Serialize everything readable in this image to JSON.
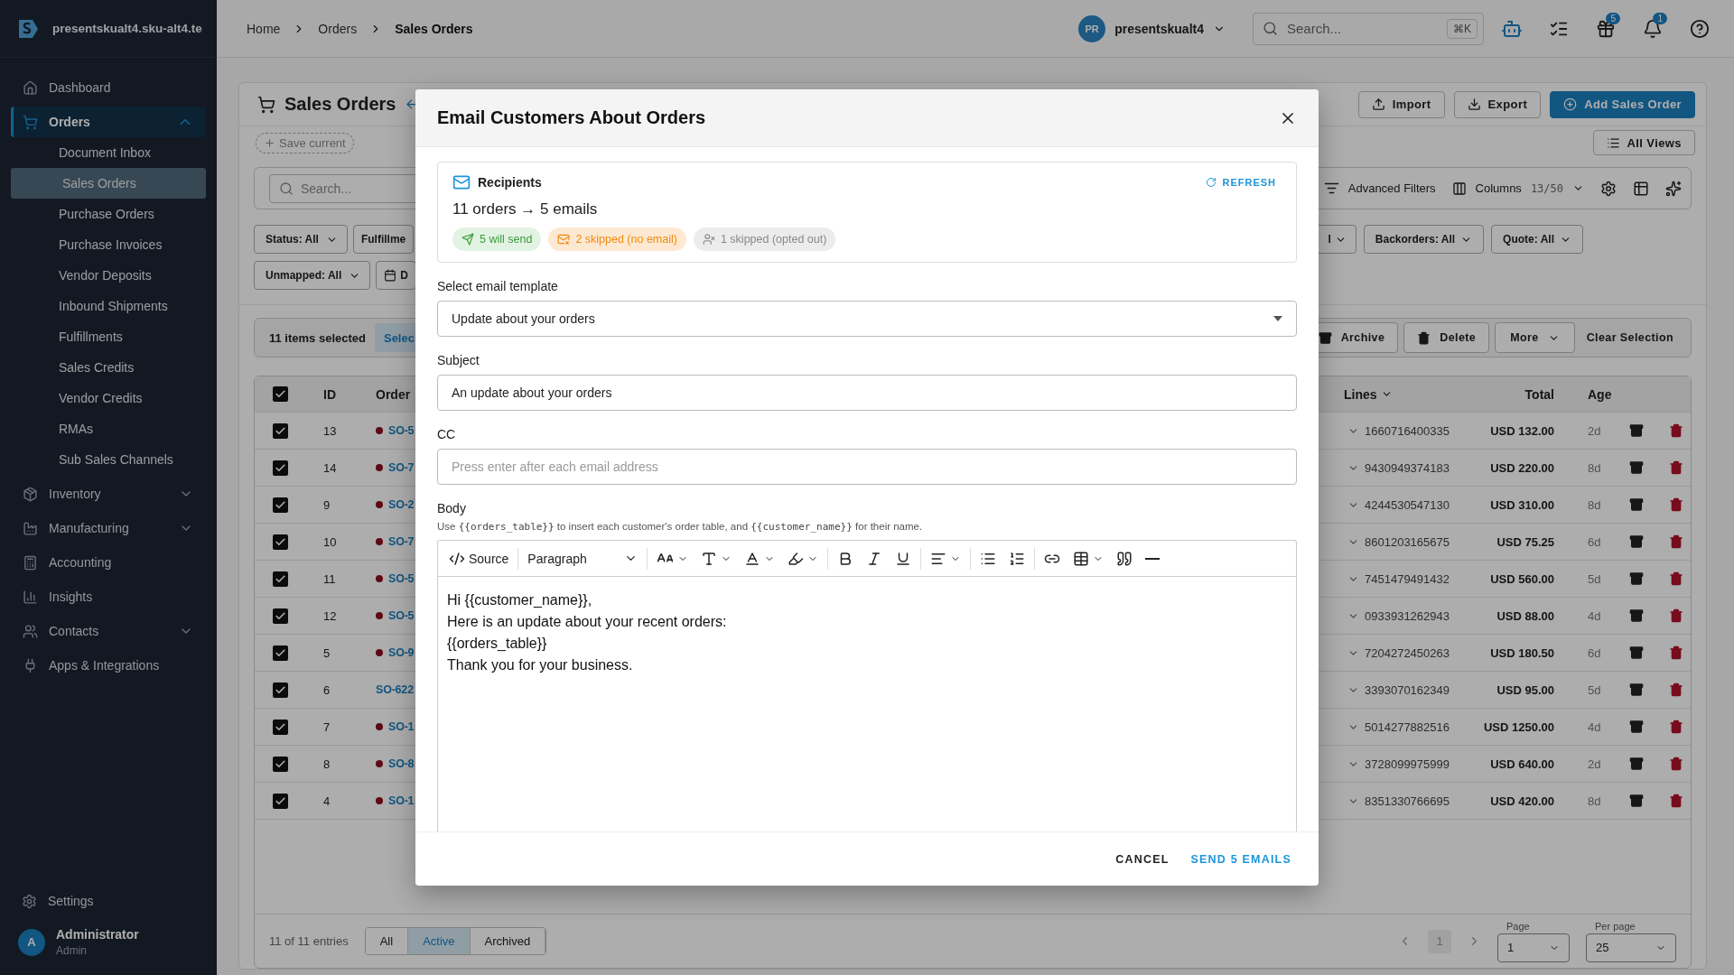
{
  "sidebar": {
    "workspace": "presentskualt4.sku-alt4.te",
    "items": [
      {
        "label": "Dashboard",
        "kind": "link",
        "selected": false
      },
      {
        "label": "Orders",
        "kind": "group",
        "expanded": true,
        "selected": true,
        "children": [
          {
            "label": "Document Inbox",
            "selected": false
          },
          {
            "label": "Sales Orders",
            "selected": true
          },
          {
            "label": "Purchase Orders",
            "selected": false
          },
          {
            "label": "Purchase Invoices",
            "selected": false
          },
          {
            "label": "Vendor Deposits",
            "selected": false
          },
          {
            "label": "Inbound Shipments",
            "selected": false
          },
          {
            "label": "Fulfillments",
            "selected": false
          },
          {
            "label": "Sales Credits",
            "selected": false
          },
          {
            "label": "Vendor Credits",
            "selected": false
          },
          {
            "label": "RMAs",
            "selected": false
          },
          {
            "label": "Sub Sales Channels",
            "selected": false
          }
        ]
      },
      {
        "label": "Inventory",
        "kind": "group",
        "expanded": false,
        "selected": false
      },
      {
        "label": "Manufacturing",
        "kind": "group",
        "expanded": false,
        "selected": false
      },
      {
        "label": "Accounting",
        "kind": "link",
        "selected": false
      },
      {
        "label": "Insights",
        "kind": "link",
        "selected": false
      },
      {
        "label": "Contacts",
        "kind": "group",
        "expanded": false,
        "selected": false
      },
      {
        "label": "Apps & Integrations",
        "kind": "link",
        "selected": false
      }
    ],
    "settings": "Settings",
    "user": {
      "initial": "A",
      "name": "Administrator",
      "role": "Admin"
    }
  },
  "header": {
    "breadcrumbs": [
      "Home",
      "Orders",
      "Sales Orders"
    ],
    "account": {
      "initials": "PR",
      "name": "presentskualt4"
    },
    "search": {
      "placeholder": "Search...",
      "shortcut": "⌘K"
    },
    "gift_badge": "5",
    "bell_badge": "1"
  },
  "page": {
    "title": "Sales Orders",
    "actions": [
      "Import",
      "Export",
      "Add Sales Order"
    ],
    "save_view": "Save current",
    "views": "All Views",
    "search": {
      "placeholder": "Search..."
    },
    "advanced_filters": "Advanced Filters",
    "columns": {
      "label": "Columns",
      "count": "13/50"
    },
    "filters_left": [
      [
        "Status: All",
        "Fulfillme"
      ],
      [
        "Unmapped: All",
        "D"
      ]
    ],
    "filters_right": [
      "l",
      "Backorders: All",
      "Quote: All"
    ],
    "selection": {
      "count": "11 items selected",
      "select": "Selec",
      "actions": [
        "Archive",
        "Delete",
        "More",
        "Clear Selection"
      ]
    },
    "table": {
      "columns": [
        "ID",
        "Order",
        "Lines",
        "Total",
        "Age"
      ],
      "all_checked": true,
      "rows": [
        {
          "checked": true,
          "id": "13",
          "order": "SO-5",
          "status_dot": true,
          "lines": "1660716400335",
          "total": "USD 132.00",
          "age": "2d"
        },
        {
          "checked": true,
          "id": "14",
          "order": "SO-7",
          "status_dot": true,
          "lines": "9430949374183",
          "total": "USD 220.00",
          "age": "8d"
        },
        {
          "checked": true,
          "id": "9",
          "order": "SO-2",
          "status_dot": true,
          "lines": "4244530547130",
          "total": "USD 310.00",
          "age": "8d"
        },
        {
          "checked": true,
          "id": "10",
          "order": "SO-7",
          "status_dot": true,
          "lines": "8601203165675",
          "total": "USD 75.25",
          "age": "6d"
        },
        {
          "checked": true,
          "id": "11",
          "order": "SO-5",
          "status_dot": true,
          "lines": "7451479491432",
          "total": "USD 560.00",
          "age": "5d"
        },
        {
          "checked": true,
          "id": "12",
          "order": "SO-5",
          "status_dot": true,
          "lines": "0933931262943",
          "total": "USD 88.00",
          "age": "4d"
        },
        {
          "checked": true,
          "id": "5",
          "order": "SO-9",
          "status_dot": true,
          "lines": "7204272450263",
          "total": "USD 180.50",
          "age": "6d"
        },
        {
          "checked": true,
          "id": "6",
          "order": "SO-622",
          "status_dot": false,
          "lines": "3393070162349",
          "total": "USD 95.00",
          "age": "5d"
        },
        {
          "checked": true,
          "id": "7",
          "order": "SO-1",
          "status_dot": true,
          "lines": "5014277882516",
          "total": "USD 1250.00",
          "age": "4d"
        },
        {
          "checked": true,
          "id": "8",
          "order": "SO-8",
          "status_dot": true,
          "lines": "3728099975999",
          "total": "USD 640.00",
          "age": "2d"
        },
        {
          "checked": true,
          "id": "4",
          "order": "SO-1",
          "status_dot": true,
          "lines": "8351330766695",
          "total": "USD 420.00",
          "age": "8d"
        }
      ]
    },
    "footer": {
      "entries": "11 of 11 entries",
      "tabs": [
        {
          "label": "All",
          "selected": false
        },
        {
          "label": "Active",
          "selected": true
        },
        {
          "label": "Archived",
          "selected": false
        }
      ],
      "current_page": "1",
      "page": {
        "label": "Page",
        "value": "1"
      },
      "per_page": {
        "label": "Per page",
        "value": "25"
      }
    }
  },
  "modal": {
    "title": "Email Customers About Orders",
    "recipients": {
      "title": "Recipients",
      "refresh": "REFRESH",
      "summary": "11 orders → 5 emails",
      "chips": [
        {
          "kind": "send",
          "text": "5 will send"
        },
        {
          "kind": "no_email",
          "text": "2 skipped (no email)"
        },
        {
          "kind": "opted_out",
          "text": "1 skipped (opted out)"
        }
      ]
    },
    "template": {
      "label": "Select email template",
      "value": "Update about your orders"
    },
    "subject": {
      "label": "Subject",
      "value": "An update about your orders"
    },
    "cc": {
      "label": "CC",
      "placeholder": "Press enter after each email address"
    },
    "body": {
      "label": "Body",
      "hint": [
        {
          "kind": "text",
          "text": "Use "
        },
        {
          "kind": "code",
          "text": "{{orders_table}}"
        },
        {
          "kind": "text",
          "text": " to insert each customer's order table, and "
        },
        {
          "kind": "code",
          "text": "{{customer_name}}"
        },
        {
          "kind": "text",
          "text": " for their name."
        }
      ],
      "source": "Source",
      "block_style": "Paragraph",
      "lines": [
        "Hi {{customer_name}},",
        "Here is an update about your recent orders:",
        "{{orders_table}}",
        "Thank you for your business."
      ]
    },
    "buttons": [
      {
        "kind": "secondary",
        "label": "CANCEL"
      },
      {
        "kind": "primary",
        "label": "SEND 5 EMAILS"
      }
    ]
  }
}
